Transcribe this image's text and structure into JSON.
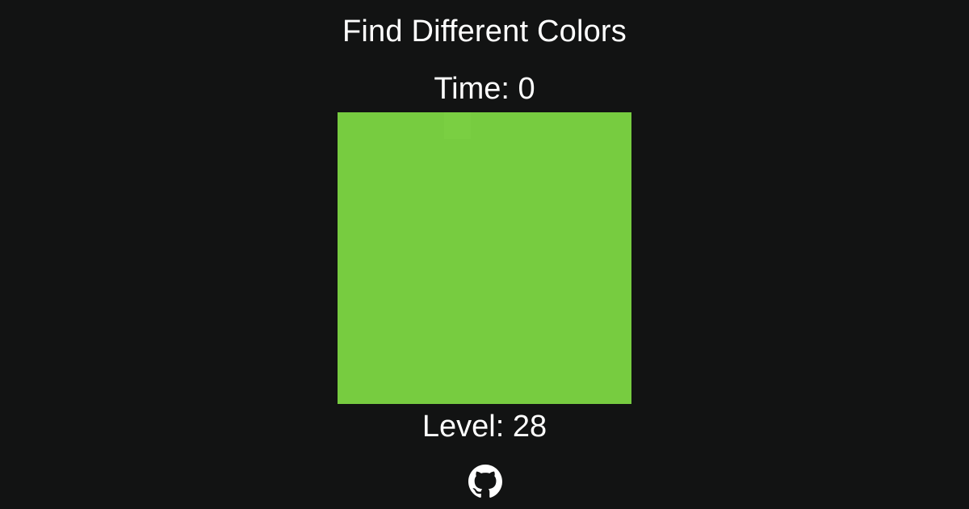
{
  "header": {
    "title": "Find Different Colors"
  },
  "status": {
    "time_label": "Time: 0",
    "time_value": 0,
    "level_label": "Level: 28",
    "level_value": 28
  },
  "board": {
    "grid_size": 11,
    "base_color": "#77cc40",
    "odd_color": "#7acf42",
    "odd_index": 4
  },
  "footer": {
    "link_icon": "github-icon"
  },
  "colors": {
    "background": "#121313",
    "text": "#ffffff"
  }
}
